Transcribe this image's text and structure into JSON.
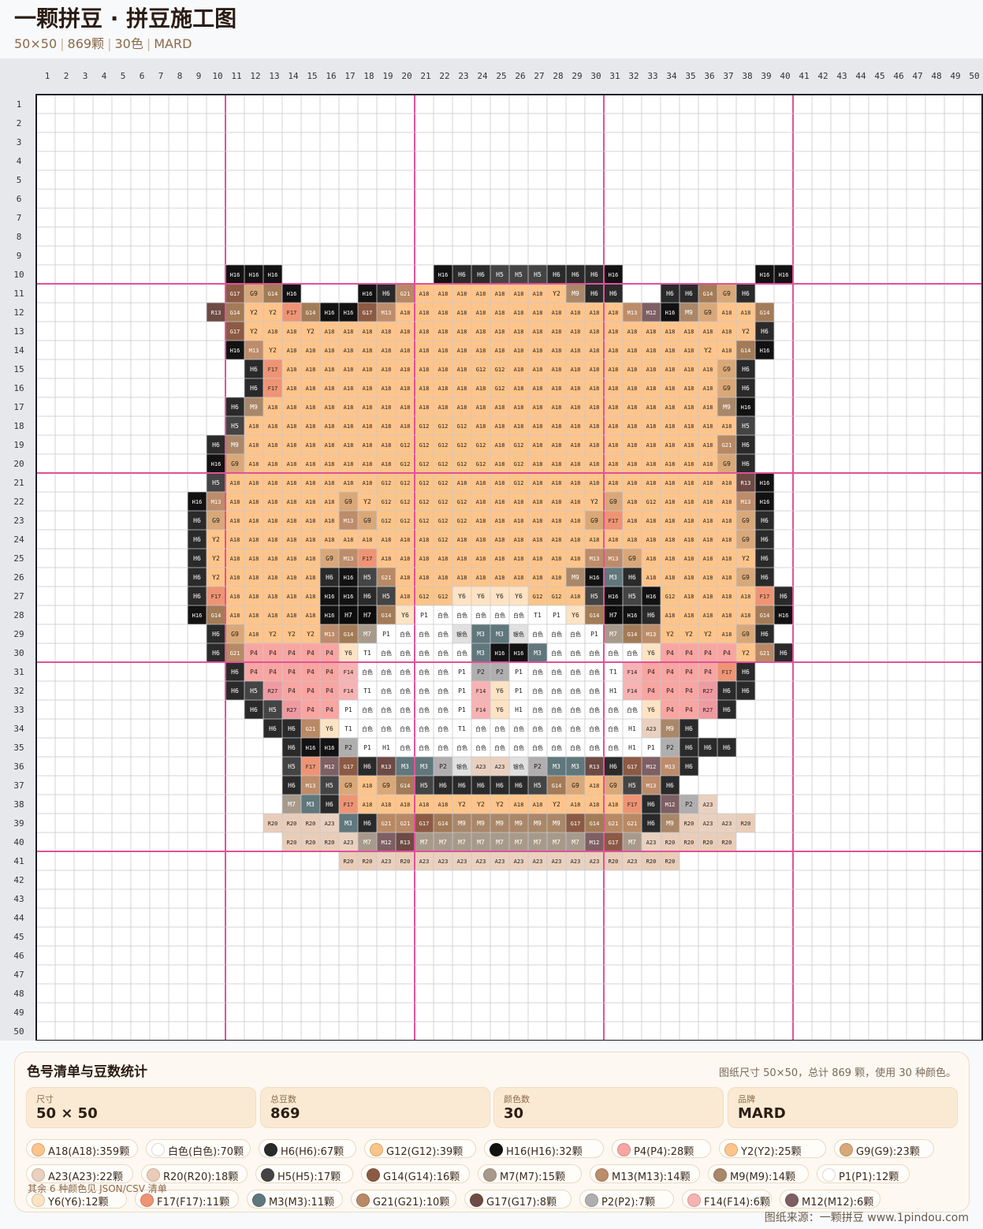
{
  "header": {
    "title": "一颗拼豆 · 拼豆施工图",
    "size": "50×50",
    "beads": "869颗",
    "colors_count": "30色",
    "brand": "MARD"
  },
  "grid": {
    "columns": 50,
    "rows": 50,
    "major_every": 10,
    "row_start": 10,
    "rows_data": [
      "..........H16|H16|H16|........H16|H6|H6|H5|H5|H5|H6|H6|H6|H16|.......H16|H16",
      "..........G17|G9|G14|H16|...H16|H6|G21|A18|A18|A18|A18|A18|A18|A18|Y2|M9|H6|H6|..H6|H6|G14|G9|H6",
      ".........R13|G14|Y2|Y2|F17|G14|H16|H16|G17|M13|A18|A18|A18|A18|A18|A18|A18|A18|A18|A18|A18|A18|M13|M12|H16|M9|G9|A18|A18|G14",
      "..........G17|Y2|A18|A18|Y2|A18|A18|A18|A18|A18|A18|A18|A18|A18|A18|A18|A18|A18|A18|A18|A18|A18|A18|A18|A18|A18|A18|Y2|H6",
      "..........H16|M13|Y2|A18|A18|A18|A18|A18|A18|A18|A18|A18|A18|A18|A18|A18|A18|A18|A18|A18|A18|A18|A18|A18|A18|Y2|A18|G14|H16",
      "...........H6|F17|A18|A18|A18|A18|A18|A18|A18|A18|A18|A18|G12|G12|A18|A18|A18|A18|A18|A18|A18|A18|A18|A18|A18|G9|H6",
      "...........H6|F17|A18|A18|A18|A18|A18|A18|A18|A18|A18|A18|A18|G12|A18|A18|A18|A18|A18|A18|A18|A18|A18|A18|A18|G9|H6",
      "..........H6|M9|A18|A18|A18|A18|A18|A18|A18|A18|A18|A18|A18|A18|A18|A18|A18|A18|A18|A18|A18|A18|A18|A18|A18|A18|M9|H16",
      "..........H5|A18|A18|A18|A18|A18|A18|A18|A18|A18|G12|G12|G12|A18|A18|A18|A18|A18|A18|A18|A18|A18|A18|A18|A18|A18|A18|H5",
      ".........H6|M9|A18|A18|A18|A18|A18|A18|A18|A18|G12|G12|G12|G12|G12|A18|G12|A18|A18|A18|A18|A18|A18|A18|A18|A18|A18|G21|H6",
      ".........H16|G9|A18|A18|A18|A18|A18|A18|A18|A18|G12|G12|G12|G12|G12|A18|G12|A18|A18|A18|A18|A18|A18|A18|A18|A18|A18|G9|H6",
      ".........H5|A18|A18|A18|A18|A18|A18|A18|A18|G12|G12|G12|G12|A18|A18|A18|G12|A18|A18|A18|A18|A18|A18|A18|A18|A18|A18|A18|R13|H16",
      "........H16|M13|A18|A18|A18|A18|A18|A18|G9|Y2|G12|G12|G12|G12|G12|A18|A18|A18|A18|A18|A18|Y2|G9|A18|G12|A18|A18|A18|A18|M13|H16",
      "........H6|G9|A18|A18|A18|A18|A18|A18|M13|G9|G12|G12|G12|G12|G12|A18|A18|A18|A18|A18|A18|G9|F17|A18|A18|A18|A18|A18|A18|G9|H6",
      "........H6|Y2|A18|A18|A18|A18|A18|A18|A18|A18|A18|A18|A18|G12|A18|A18|A18|A18|A18|A18|A18|A18|A18|A18|A18|A18|A18|A18|A18|G9|H6",
      "........H6|Y2|A18|A18|A18|A18|A18|G9|M13|F17|A18|A18|A18|A18|A18|A18|A18|A18|A18|A18|A18|M13|M13|G9|A18|A18|A18|A18|A18|Y2|H6",
      "........H6|Y2|A18|A18|A18|A18|A18|H6|H16|H5|G21|A18|A18|A18|A18|A18|A18|A18|A18|A18|M9|H16|M3|H6|A18|A18|A18|A18|A18|G9|H6",
      "........H6|F17|A18|A18|A18|A18|A18|H16|H16|H6|H5|A18|G12|G12|Y6|Y6|Y6|Y6|G12|G12|A18|H5|H16|H5|H16|G12|A18|A18|A18|A18|F17|H6",
      "........H16|G14|A18|A18|A18|A18|A18|H16|H7|H7|G14|Y6|P1|白色|白色|白色|白色|白色|T1|P1|Y6|G14|H7|H16|H6|A18|A18|A18|A18|A18|G14|H16",
      ".........H6|G9|A18|Y2|Y2|Y2|M13|G14|M7|P1|白色|白色|白色|银色|M3|M3|银色|白色|白色|白色|P1|M7|G14|M13|Y2|Y2|Y2|A18|G9|H6",
      ".........H6|G21|P4|P4|P4|P4|P4|Y6|T1|白色|白色|白色|白色|白色|M3|H16|H16|M3|白色|白色|白色|白色|白色|Y6|P4|P4|P4|P4|Y2|G21|H6",
      "..........H6|P4|P4|P4|P4|P4|F14|白色|白色|白色|白色|白色|P1|P2|P2|P1|白色|白色|白色|白色|T1|F14|P4|P4|P4|P4|F17|H6",
      "..........H6|H5|R27|P4|P4|P4|F14|T1|白色|白色|白色|白色|P1|F14|Y6|P1|白色|白色|白色|白色|H1|F14|P4|P4|P4|R27|H6|H6",
      "...........H6|H5|R27|P4|P4|P1|白色|白色|白色|白色|白色|P1|F14|Y6|H1|白色|白色|白色|白色|白色|白色|Y6|P4|P4|R27|H6",
      "............H6|H6|G21|Y6|T1|白色|白色|白色|白色|白色|T1|白色|白色|白色|白色|白色|白色|白色|白色|H1|A23|M9|H6",
      ".............H6|H16|H16|P2|P1|H1|白色|白色|白色|白色|白色|白色|白色|白色|白色|白色|白色|白色|H1|P1|P2|H6|H6|H6",
      ".............H5|F17|M12|G17|H6|R13|M3|M3|P2|银色|A23|A23|银色|P2|M3|M3|R13|H6|G17|M12|M13|H6",
      ".............H6|M13|H5|G9|A18|G9|G14|H5|H6|H6|H6|H6|H6|H5|G14|G9|A18|G9|H5|M13|H6",
      ".............M7|M3|H6|F17|A18|A18|A18|A18|A18|Y2|Y2|Y2|A18|A18|Y2|A18|A18|A18|F17|H6|M12|P2|A23",
      "............R20|R20|R20|A23|M3|H6|G21|G21|G17|G14|M9|M9|M9|M9|M9|M9|G17|G14|G21|G21|H6|M9|R20|A23|A23|R20",
      ".............R20|R20|R20|A23|M7|M12|R13|M7|M7|M7|M7|M7|M7|M7|M7|M7|M12|G17|M7|A23|R20|R20|R20|R20",
      "................R20|R20|A23|R20|A23|A23|A23|A23|A23|A23|A23|A23|A23|A23|R20|A23|R20|R20"
    ]
  },
  "palette": {
    "A18": "#ffc48a",
    "G12": "#fbc488",
    "G9": "#d9a878",
    "G14": "#a37b57",
    "G17": "#8c5a44",
    "G21": "#b88964",
    "Y2": "#ffc48a",
    "Y6": "#fde3c3",
    "F17": "#ee9474",
    "F14": "#f7b3b3",
    "P4": "#f9a5a1",
    "P1": "#ffffff",
    "P2": "#b0aeae",
    "R13": "#6d4a44",
    "R20": "#e9cdb9",
    "R27": "#ef9aa0",
    "M3": "#60777c",
    "M7": "#a89a8b",
    "M9": "#a98768",
    "M12": "#7e5f63",
    "M13": "#bd8c6a",
    "A23": "#ead1bf",
    "H1": "#ffffff",
    "H5": "#444444",
    "H6": "#2a2a2a",
    "H7": "#0c0c0c",
    "H16": "#121212",
    "T1": "#ffffff",
    "白色": "#ffffff",
    "银色": "#e0e0e0"
  },
  "panel": {
    "title": "色号清单与豆数统计",
    "summary": "图纸尺寸 50×50，总计 869 颗，使用 30 种颜色。",
    "stats": [
      {
        "label": "尺寸",
        "value": "50 × 50"
      },
      {
        "label": "总豆数",
        "value": "869"
      },
      {
        "label": "颜色数",
        "value": "30"
      },
      {
        "label": "品牌",
        "value": "MARD"
      }
    ],
    "chips": [
      {
        "text": "A18(A18):359颗",
        "color": "#ffc48a"
      },
      {
        "text": "白色(白色):70颗",
        "color": "#ffffff"
      },
      {
        "text": "H6(H6):67颗",
        "color": "#2a2a2a"
      },
      {
        "text": "G12(G12):39颗",
        "color": "#fbc488"
      },
      {
        "text": "H16(H16):32颗",
        "color": "#121212"
      },
      {
        "text": "P4(P4):28颗",
        "color": "#f9a5a1"
      },
      {
        "text": "Y2(Y2):25颗",
        "color": "#ffc48a"
      },
      {
        "text": "G9(G9):23颗",
        "color": "#d9a878"
      },
      {
        "text": "A23(A23):22颗",
        "color": "#ead1bf"
      },
      {
        "text": "R20(R20):18颗",
        "color": "#e9cdb9"
      },
      {
        "text": "H5(H5):17颗",
        "color": "#444444"
      },
      {
        "text": "G14(G14):16颗",
        "color": "#8c5a44"
      },
      {
        "text": "M7(M7):15颗",
        "color": "#a89a8b"
      },
      {
        "text": "M13(M13):14颗",
        "color": "#bd8c6a"
      },
      {
        "text": "M9(M9):14颗",
        "color": "#a98768"
      },
      {
        "text": "P1(P1):12颗",
        "color": "#ffffff"
      },
      {
        "text": "Y6(Y6):12颗",
        "color": "#fde3c3"
      },
      {
        "text": "F17(F17):11颗",
        "color": "#ee9474"
      },
      {
        "text": "M3(M3):11颗",
        "color": "#60777c"
      },
      {
        "text": "G21(G21):10颗",
        "color": "#b88964"
      },
      {
        "text": "G17(G17):8颗",
        "color": "#6d4a44"
      },
      {
        "text": "P2(P2):7颗",
        "color": "#b0aeae"
      },
      {
        "text": "F14(F14):6颗",
        "color": "#f7b3b3"
      },
      {
        "text": "M12(M12):6颗",
        "color": "#7e5f63"
      }
    ],
    "more_note": "其余 6 种颜色见 JSON/CSV 清单"
  },
  "footer": "图纸来源：一颗拼豆 www.1pindou.com"
}
